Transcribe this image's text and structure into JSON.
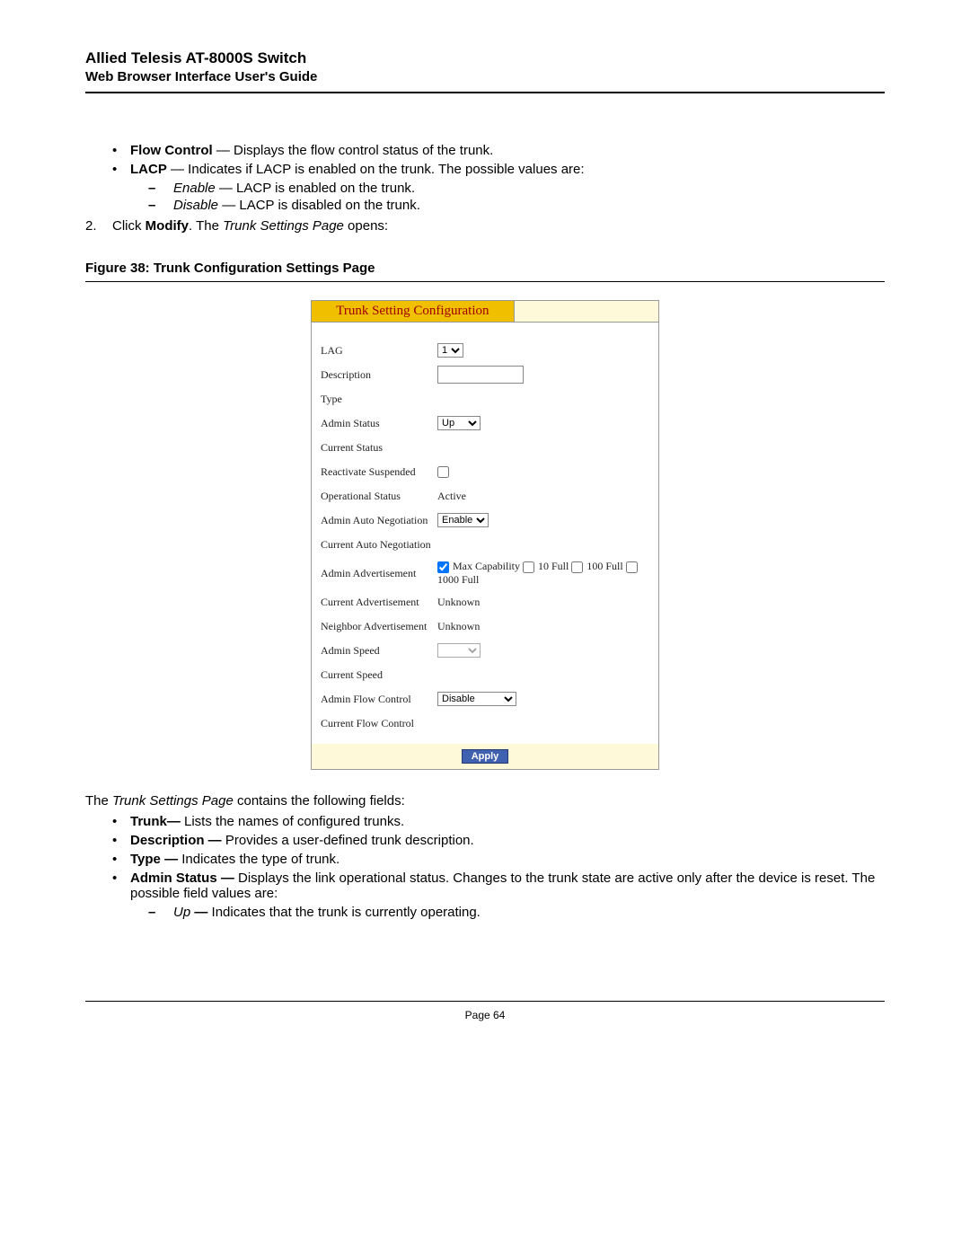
{
  "header": {
    "title": "Allied Telesis AT-8000S Switch",
    "subtitle": "Web Browser Interface User's Guide"
  },
  "top_bullets": [
    {
      "bold": "Flow Control",
      "rest": " — Displays the flow control status of the trunk."
    },
    {
      "bold": "LACP",
      "rest": " — Indicates if LACP is enabled on the trunk. The possible values are:"
    }
  ],
  "lacp_sub": [
    {
      "ital": "Enable",
      "rest": " — LACP is enabled on the trunk."
    },
    {
      "ital": "Disable",
      "rest": " — LACP is disabled on the trunk."
    }
  ],
  "step2": {
    "num": "2.",
    "pre": "Click ",
    "bold": "Modify",
    "mid": ". The ",
    "ital": "Trunk Settings Page",
    "post": " opens:"
  },
  "figure_caption": "Figure 38:  Trunk Configuration Settings Page",
  "panel": {
    "title": "Trunk Setting Configuration",
    "rows": {
      "lag": {
        "label": "LAG",
        "value": "1"
      },
      "description": {
        "label": "Description",
        "value": ""
      },
      "type": {
        "label": "Type",
        "value": ""
      },
      "admin_status": {
        "label": "Admin Status",
        "value": "Up"
      },
      "current_status": {
        "label": "Current Status",
        "value": ""
      },
      "reactivate": {
        "label": "Reactivate Suspended"
      },
      "operational_status": {
        "label": "Operational Status",
        "value": "Active"
      },
      "admin_auto_neg": {
        "label": "Admin Auto Negotiation",
        "value": "Enable"
      },
      "current_auto_neg": {
        "label": "Current Auto Negotiation",
        "value": ""
      },
      "admin_adv": {
        "label": "Admin Advertisement",
        "opts": [
          "Max Capability",
          "10 Full",
          "100 Full",
          "1000 Full"
        ]
      },
      "current_adv": {
        "label": "Current Advertisement",
        "value": "Unknown"
      },
      "neighbor_adv": {
        "label": "Neighbor Advertisement",
        "value": "Unknown"
      },
      "admin_speed": {
        "label": "Admin Speed",
        "value": ""
      },
      "current_speed": {
        "label": "Current Speed",
        "value": ""
      },
      "admin_flow": {
        "label": "Admin Flow Control",
        "value": "Disable"
      },
      "current_flow": {
        "label": "Current Flow Control",
        "value": ""
      }
    },
    "apply": "Apply"
  },
  "below_intro": {
    "pre": "The ",
    "ital": "Trunk Settings Page",
    "post": " contains the following fields:"
  },
  "below_bullets": [
    {
      "bold": "Trunk—",
      "rest": " Lists the names of configured trunks."
    },
    {
      "bold": "Description —",
      "rest": " Provides a user-defined trunk description."
    },
    {
      "bold": "Type —",
      "rest": " Indicates the type of trunk."
    },
    {
      "bold": "Admin Status —",
      "rest": " Displays the link operational status. Changes to the trunk state are active only after the device is reset. The possible field values are:"
    }
  ],
  "below_sub": [
    {
      "ital": "Up",
      "bold": " —",
      "rest": " Indicates that the trunk is currently operating."
    }
  ],
  "page_number": "Page 64"
}
